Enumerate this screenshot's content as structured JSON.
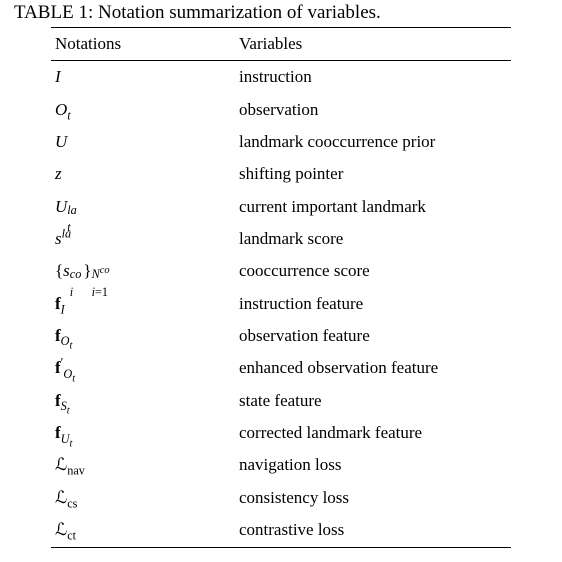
{
  "caption": "TABLE 1: Notation summarization of variables.",
  "headers": {
    "col1": "Notations",
    "col2": "Variables"
  },
  "rows": [
    {
      "notation_html": "<span class='it'>I</span>",
      "variable": "instruction"
    },
    {
      "notation_html": "<span class='it'>O</span><span class='sub it'>t</span>",
      "variable": "observation"
    },
    {
      "notation_html": "<span class='it'>U</span>",
      "variable": "landmark cooccurrence prior"
    },
    {
      "notation_html": "<span class='it'>z</span>",
      "variable": "shifting pointer"
    },
    {
      "notation_html": "<span class='it'>U</span><span class='subsup'><span class='ssup it'>la</span><span class='ssub it'>t</span></span>",
      "variable": "current important landmark"
    },
    {
      "notation_html": "<span class='it'>s</span><span class='sup it'>la</span>",
      "variable": "landmark score"
    },
    {
      "notation_html": "{<span class='it'>s</span><span class='subsup'><span class='ssup it'>co</span><span class='ssub it'>i</span></span>&thinsp;}<span class='subsup'><span class='ssup'><span class='it'>N</span><span class='sup it' style='font-size:0.85em'>co</span></span><span class='ssub'><span class='it'>i</span>=1</span></span>",
      "variable": "cooccurrence score"
    },
    {
      "notation_html": "<span class='bf'>f</span><span class='sub it'>I</span>",
      "variable": "instruction feature"
    },
    {
      "notation_html": "<span class='bf'>f</span><span class='sub'><span class='it'>O</span><span class='sub it' style='font-size:0.85em'>t</span></span>",
      "variable": "observation feature"
    },
    {
      "notation_html": "<span class='bf'>f</span><span class='prime sup'>&prime;</span><span class='sub'><span class='it'>O</span><span class='sub it' style='font-size:0.85em'>t</span></span>",
      "variable": "enhanced observation feature"
    },
    {
      "notation_html": "<span class='bf'>f</span><span class='sub'><span class='it'>S</span><span class='sub it' style='font-size:0.85em'>t</span></span>",
      "variable": "state feature"
    },
    {
      "notation_html": "<span class='bf'>f</span><span class='sub'><span class='it'>U</span><span class='sub it' style='font-size:0.85em'>t</span></span>",
      "variable": "corrected landmark feature"
    },
    {
      "notation_html": "<span class='calL'>&#8466;</span><span class='sub rm'>nav</span>",
      "variable": "navigation loss"
    },
    {
      "notation_html": "<span class='calL'>&#8466;</span><span class='sub rm'>cs</span>",
      "variable": "consistency loss"
    },
    {
      "notation_html": "<span class='calL'>&#8466;</span><span class='sub rm'>ct</span>",
      "variable": "contrastive loss"
    }
  ]
}
